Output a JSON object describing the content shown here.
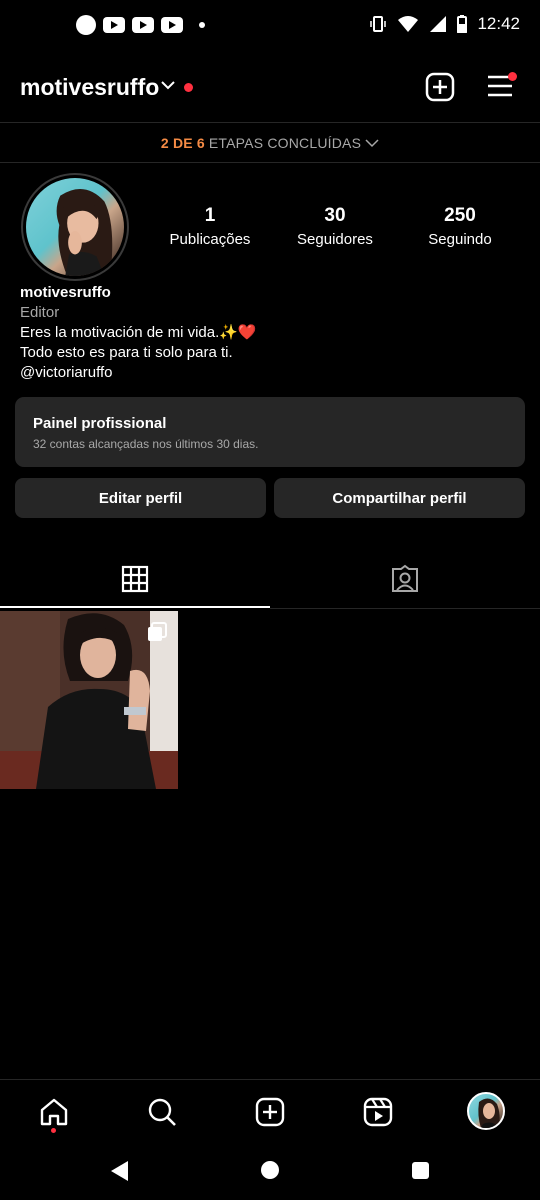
{
  "status_bar": {
    "time": "12:42",
    "left_icons": [
      "circle-icon",
      "youtube-icon",
      "youtube-icon",
      "youtube-icon",
      "dot-icon"
    ],
    "right_icons": [
      "vibrate-icon",
      "wifi-icon",
      "signal-icon",
      "battery-icon"
    ]
  },
  "header": {
    "username": "motivesruffo",
    "has_notification_dot": true,
    "icons": [
      "chevron-down-icon",
      "new-post-icon",
      "menu-icon"
    ]
  },
  "steps": {
    "progress_text": "2 DE 6",
    "label": "ETAPAS CONCLUÍDAS"
  },
  "profile": {
    "stats": [
      {
        "value": "1",
        "label": "Publicações"
      },
      {
        "value": "30",
        "label": "Seguidores"
      },
      {
        "value": "250",
        "label": "Seguindo"
      }
    ],
    "name": "motivesruffo",
    "category": "Editor",
    "bio_line1": "Eres la motivación de mi vida.✨❤️",
    "bio_line2": "Todo esto es para ti solo para ti.",
    "bio_line3": "@victoriaruffo"
  },
  "pro_panel": {
    "title": "Painel profissional",
    "subtitle": "32 contas alcançadas nos últimos 30 dias."
  },
  "buttons": {
    "edit": "Editar perfil",
    "share": "Compartilhar perfil"
  },
  "tabs": [
    "grid-icon",
    "tagged-icon"
  ],
  "bottom_nav": [
    "home-icon",
    "search-icon",
    "create-icon",
    "reels-icon",
    "profile-avatar"
  ],
  "colors": {
    "background": "#000000",
    "surface": "#262626",
    "accent_orange": "#f58b45",
    "notification_red": "#ff3040",
    "muted_text": "#a8a8a8"
  }
}
